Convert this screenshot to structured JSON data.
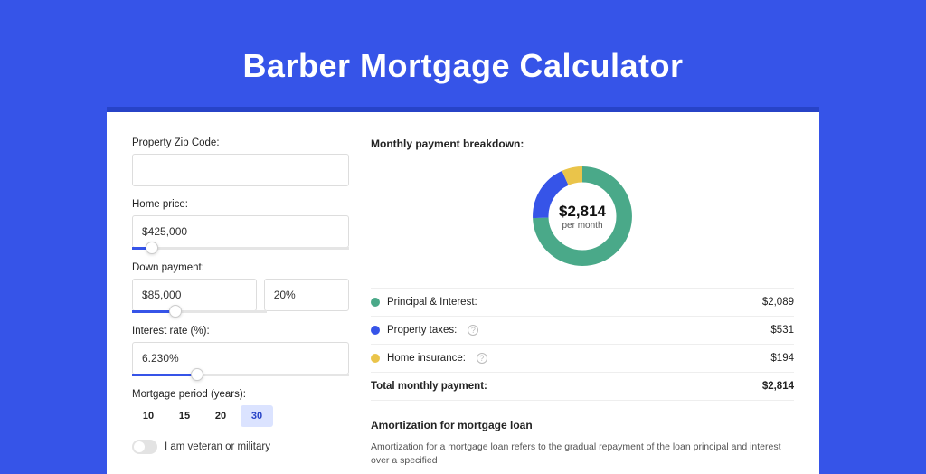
{
  "headline": "Barber Mortgage Calculator",
  "form": {
    "zip_label": "Property Zip Code:",
    "zip_value": "",
    "home_price_label": "Home price:",
    "home_price_value": "$425,000",
    "down_payment_label": "Down payment:",
    "down_payment_value": "$85,000",
    "down_payment_pct": "20%",
    "interest_label": "Interest rate (%):",
    "interest_value": "6.230%",
    "period_label": "Mortgage period (years):",
    "periods": [
      "10",
      "15",
      "20",
      "30"
    ],
    "period_selected": "30",
    "veteran_label": "I am veteran or military",
    "slider_home_pct": 9,
    "slider_down_pct": 20,
    "slider_rate_pct": 30
  },
  "breakdown": {
    "title": "Monthly payment breakdown:",
    "center_amount": "$2,814",
    "center_sub": "per month",
    "items": [
      {
        "label": "Principal & Interest:",
        "value": "$2,089",
        "num": 2089,
        "color": "#4aa989",
        "help": false
      },
      {
        "label": "Property taxes:",
        "value": "$531",
        "num": 531,
        "color": "#3654e8",
        "help": true
      },
      {
        "label": "Home insurance:",
        "value": "$194",
        "num": 194,
        "color": "#eac44a",
        "help": true
      }
    ],
    "total_label": "Total monthly payment:",
    "total_value": "$2,814",
    "total_num": 2814
  },
  "chart_data": {
    "type": "pie",
    "title": "Monthly payment breakdown",
    "series": [
      {
        "name": "Principal & Interest",
        "value": 2089,
        "color": "#4aa989"
      },
      {
        "name": "Property taxes",
        "value": 531,
        "color": "#3654e8"
      },
      {
        "name": "Home insurance",
        "value": 194,
        "color": "#eac44a"
      }
    ],
    "center_label": "$2,814 per month"
  },
  "amortization": {
    "title": "Amortization for mortgage loan",
    "body": "Amortization for a mortgage loan refers to the gradual repayment of the loan principal and interest over a specified"
  }
}
